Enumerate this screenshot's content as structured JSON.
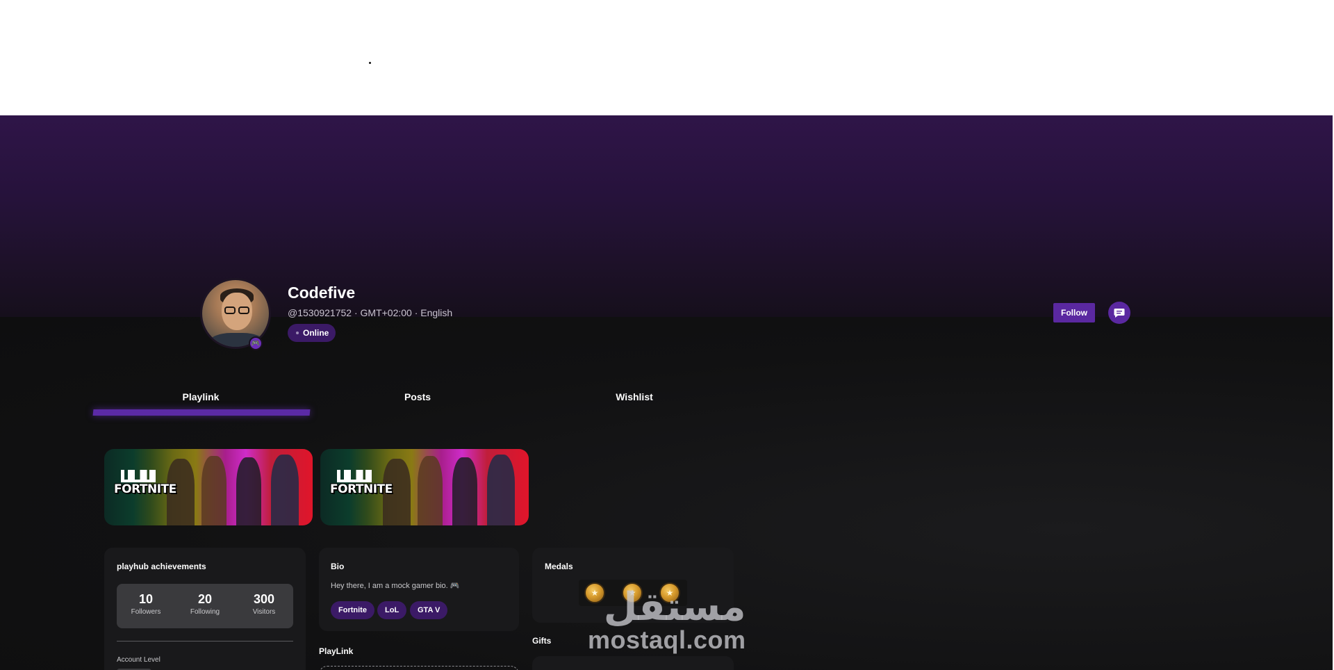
{
  "profile": {
    "username": "Codefive",
    "meta": "@1530921752 · GMT+02:00 · English",
    "status": "Online"
  },
  "actions": {
    "follow_label": "Follow"
  },
  "tabs": [
    {
      "label": "Playlink",
      "active": true
    },
    {
      "label": "Posts",
      "active": false
    },
    {
      "label": "Wishlist",
      "active": false
    }
  ],
  "games": [
    {
      "logo_text": "FORTNITE"
    },
    {
      "logo_text": "FORTNITE"
    }
  ],
  "achievements": {
    "title": "playhub achievements",
    "stats": [
      {
        "value": "10",
        "label": "Followers"
      },
      {
        "value": "20",
        "label": "Following"
      },
      {
        "value": "300",
        "label": "Visitors"
      }
    ],
    "account_level_label": "Account Level"
  },
  "bio": {
    "title": "Bio",
    "text": "Hey there, I am a mock gamer bio. 🎮",
    "tags": [
      "Fortnite",
      "LoL",
      "GTA V"
    ]
  },
  "playlink": {
    "title": "PlayLink"
  },
  "medals": {
    "title": "Medals",
    "count": 3
  },
  "gifts": {
    "title": "Gifts"
  },
  "watermark": {
    "arabic": "مستقل",
    "latin": "mostaql.com"
  },
  "colors": {
    "accent": "#5a28a0",
    "banner": "#2f1548",
    "background": "#0e0e0f",
    "panel": "#19191b"
  }
}
